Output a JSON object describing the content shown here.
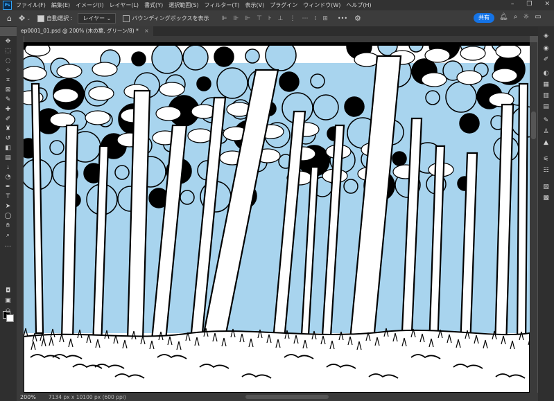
{
  "app": {
    "logo": "Ps"
  },
  "menu": [
    "ファイル(F)",
    "編集(E)",
    "イメージ(I)",
    "レイヤー(L)",
    "書式(Y)",
    "選択範囲(S)",
    "フィルター(T)",
    "表示(V)",
    "プラグイン",
    "ウィンドウ(W)",
    "ヘルプ(H)"
  ],
  "options": {
    "auto_select_label": "自動選択 :",
    "layer_select": "レイヤー",
    "bounding_box_label": "バウンディングボックスを表示",
    "more": "•••",
    "share": "共有"
  },
  "document": {
    "tab_title": "ep0001_01.psd @ 200% (木の葉, グリーン/8) *",
    "close": "×"
  },
  "status": {
    "zoom": "200%",
    "doc_info": "7134 px x 10100 px (600 ppi)"
  },
  "icons": {
    "home": "home-icon",
    "move": "move-icon",
    "settings": "gear-icon",
    "search": "search-icon",
    "help": "lightbulb-icon"
  },
  "colors": {
    "sky_blue": "#a8d4ee",
    "ink": "#000000",
    "accent": "#1473e6",
    "foreground": "#000000",
    "background": "#ffffff"
  }
}
